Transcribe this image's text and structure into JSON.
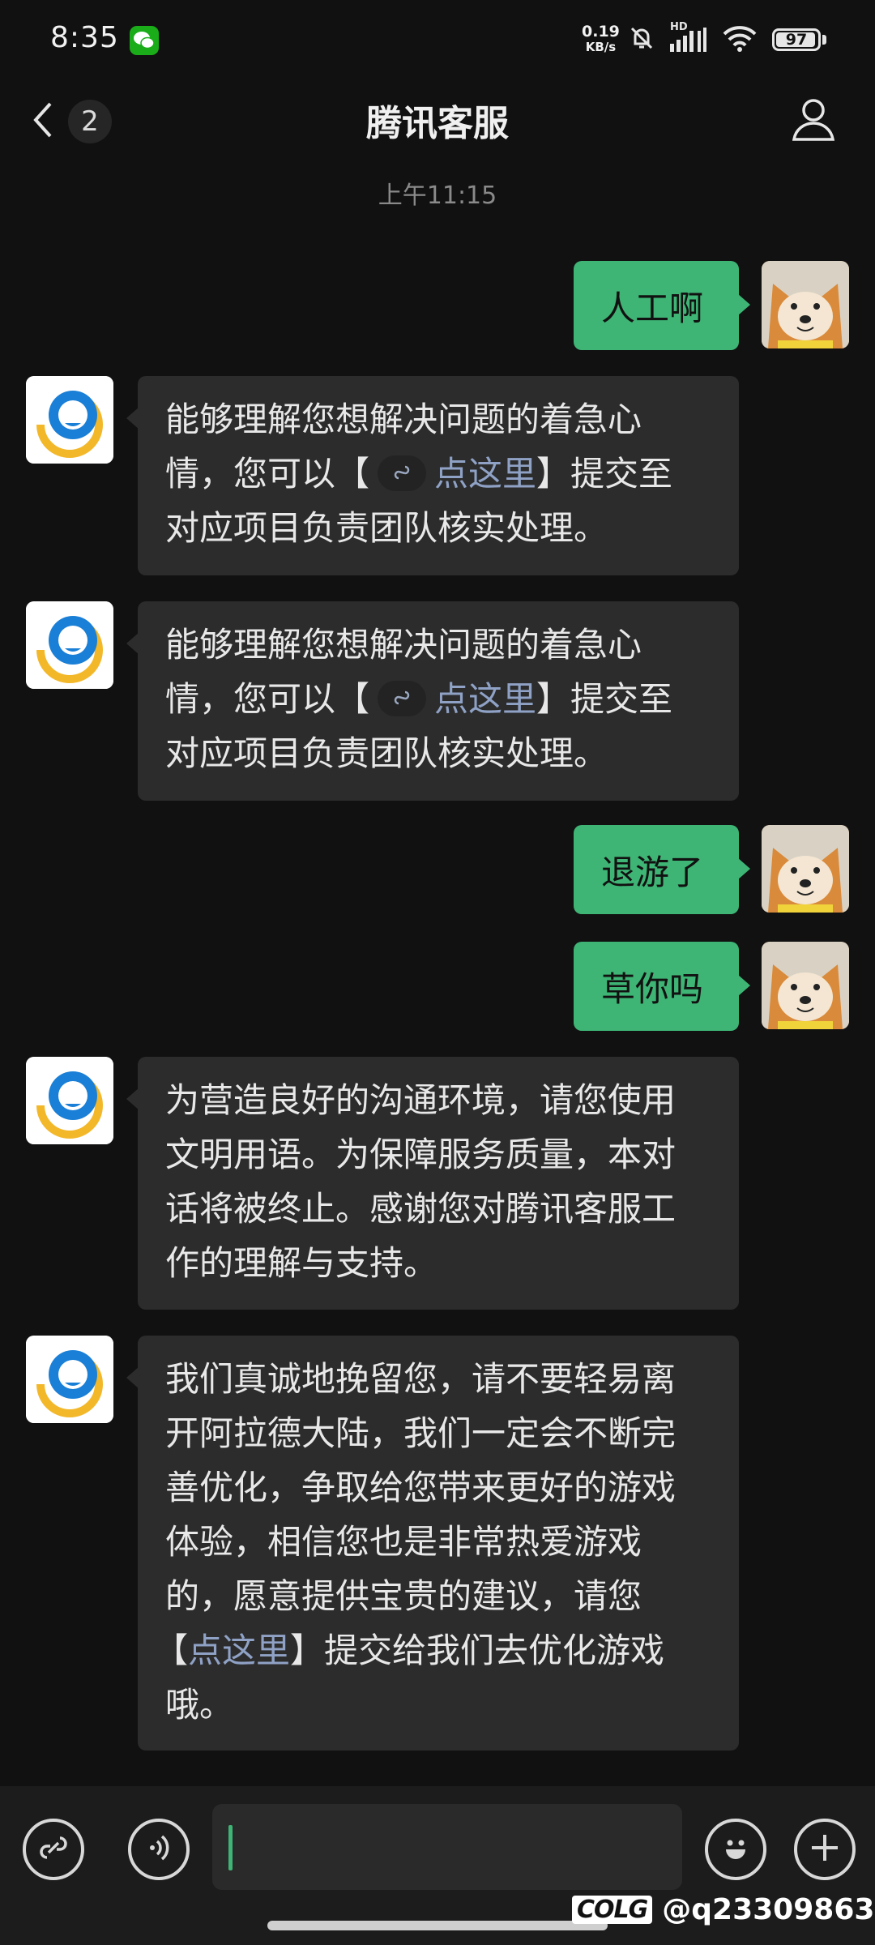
{
  "status_bar": {
    "time": "8:35",
    "net_speed_value": "0.19",
    "net_speed_unit": "KB/s",
    "network_label": "HD",
    "battery_level": "97"
  },
  "nav": {
    "unread_count": "2",
    "title": "腾讯客服"
  },
  "timestamp": "上午11:15",
  "messages": [
    {
      "side": "out",
      "text": "人工啊"
    },
    {
      "side": "in",
      "line1": "能够理解您想解决问题的着急心",
      "line2_pre": "情，您可以【",
      "link": "点这里",
      "line2_post": "】提交至",
      "line3": "对应项目负责团队核实处理。"
    },
    {
      "side": "in",
      "line1": "能够理解您想解决问题的着急心",
      "line2_pre": "情，您可以【",
      "link": "点这里",
      "line2_post": "】提交至",
      "line3": "对应项目负责团队核实处理。"
    },
    {
      "side": "out",
      "text": "退游了"
    },
    {
      "side": "out",
      "text": "草你吗"
    },
    {
      "side": "in",
      "line1": "为营造良好的沟通环境，请您使用",
      "line2": "文明用语。为保障服务质量，本对",
      "line3": "话将被终止。感谢您对腾讯客服工",
      "line4": "作的理解与支持。"
    },
    {
      "side": "in",
      "line1": "我们真诚地挽留您，请不要轻易离",
      "line2": "开阿拉德大陆，我们一定会不断完",
      "line3": "善优化，争取给您带来更好的游戏",
      "line4": "体验，相信您也是非常热爱游戏",
      "line5": "的，愿意提供宝贵的建议，请您",
      "line6_pre": "【",
      "link": "点这里",
      "line6_post": "】提交给我们去优化游戏",
      "line7": "哦。"
    }
  ],
  "input": {
    "value": ""
  },
  "watermark": {
    "logo": "COLG",
    "handle": "@q23309863"
  },
  "colors": {
    "accent": "#3eb575",
    "background": "#111111",
    "bubble_in": "#2c2c2c",
    "link": "#8fa2c6"
  },
  "icons": [
    "wechat-icon",
    "mute-icon",
    "signal-icon",
    "wifi-icon",
    "battery-icon",
    "back-chevron-icon",
    "person-icon",
    "mini-program-link-icon",
    "voice-icon",
    "emoji-icon",
    "plus-icon"
  ]
}
